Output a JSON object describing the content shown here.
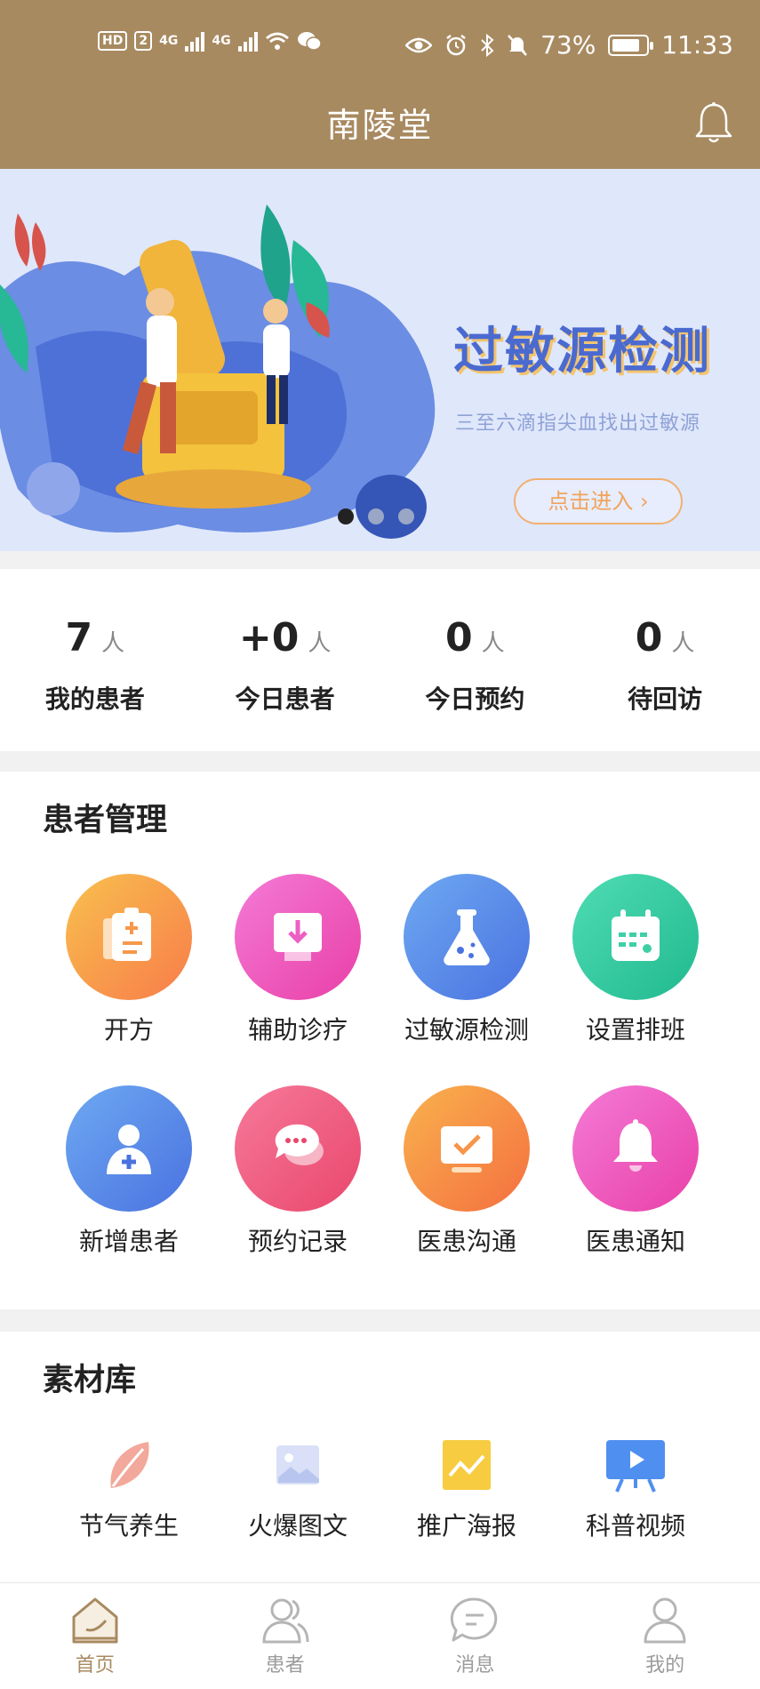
{
  "status_bar": {
    "hd": "HD",
    "sim": "2",
    "net1": "4G",
    "net2": "4G",
    "battery": "73%",
    "time": "11:33"
  },
  "header": {
    "title": "南陵堂",
    "bell_icon": "bell-icon"
  },
  "banner": {
    "title": "过敏源检测",
    "subtitle": "三至六滴指尖血找出过敏源",
    "button": "点击进入 ›",
    "dots": 3,
    "active_dot": 0
  },
  "stats": [
    {
      "value": "7",
      "unit": "人",
      "label": "我的患者"
    },
    {
      "value": "+0",
      "unit": "人",
      "label": "今日患者"
    },
    {
      "value": "0",
      "unit": "人",
      "label": "今日预约"
    },
    {
      "value": "0",
      "unit": "人",
      "label": "待回访"
    }
  ],
  "patient_management": {
    "title": "患者管理",
    "items": [
      {
        "label": "开方",
        "icon": "prescription-icon",
        "color": "#f7a24a"
      },
      {
        "label": "辅助诊疗",
        "icon": "download-screen-icon",
        "color": "#ec5fc3"
      },
      {
        "label": "过敏源检测",
        "icon": "flask-icon",
        "color": "#5c8ee8"
      },
      {
        "label": "设置排班",
        "icon": "calendar-icon",
        "color": "#3fcfa7"
      },
      {
        "label": "新增患者",
        "icon": "add-person-icon",
        "color": "#5c8ee8"
      },
      {
        "label": "预约记录",
        "icon": "chat-bubbles-icon",
        "color": "#f06a8a"
      },
      {
        "label": "医患沟通",
        "icon": "monitor-check-icon",
        "color": "#f7954a"
      },
      {
        "label": "医患通知",
        "icon": "bell-icon",
        "color": "#ec5fc3"
      }
    ]
  },
  "materials": {
    "title": "素材库",
    "items": [
      {
        "label": "节气养生",
        "icon": "leaf-icon"
      },
      {
        "label": "火爆图文",
        "icon": "image-icon"
      },
      {
        "label": "推广海报",
        "icon": "poster-chart-icon"
      },
      {
        "label": "科普视频",
        "icon": "video-screen-icon"
      }
    ]
  },
  "tabbar": [
    {
      "label": "首页",
      "icon": "home-icon",
      "active": true
    },
    {
      "label": "患者",
      "icon": "patients-icon",
      "active": false
    },
    {
      "label": "消息",
      "icon": "message-icon",
      "active": false
    },
    {
      "label": "我的",
      "icon": "profile-icon",
      "active": false
    }
  ],
  "colors": {
    "brand": "#a88a61",
    "banner_bg": "#dfe7fb"
  }
}
